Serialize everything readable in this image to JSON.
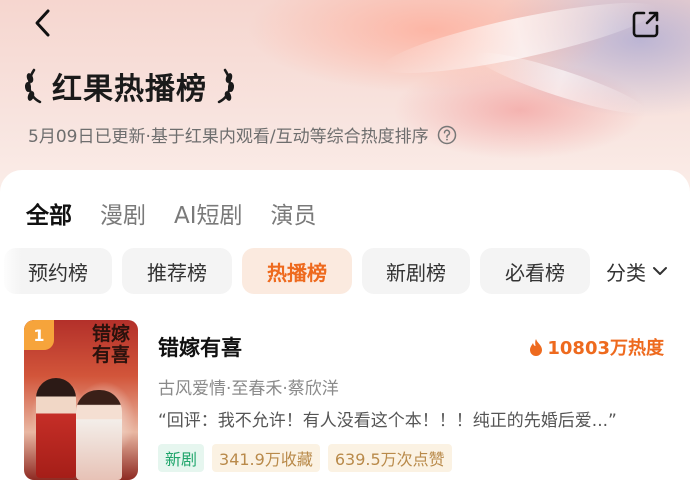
{
  "header": {
    "title": "红果热播榜",
    "subtitle": "5月09日已更新·基于红果内观看/互动等综合热度排序"
  },
  "tabs": [
    {
      "label": "全部",
      "active": true
    },
    {
      "label": "漫剧",
      "active": false
    },
    {
      "label": "AI短剧",
      "active": false
    },
    {
      "label": "演员",
      "active": false
    }
  ],
  "chips": [
    {
      "label": "预约榜",
      "active": false
    },
    {
      "label": "推荐榜",
      "active": false
    },
    {
      "label": "热播榜",
      "active": true
    },
    {
      "label": "新剧榜",
      "active": false
    },
    {
      "label": "必看榜",
      "active": false
    }
  ],
  "category_label": "分类",
  "items": [
    {
      "rank": "1",
      "poster_title": "错嫁有喜",
      "title": "错嫁有喜",
      "heat": "10803万热度",
      "meta": "古风爱情·至春禾·蔡欣洋",
      "quote": "“回评：我不允许！有人没看这个本！！！纯正的先婚后爱...”",
      "tags": [
        {
          "label": "新剧",
          "style": "green"
        },
        {
          "label": "341.9万收藏",
          "style": "tan"
        },
        {
          "label": "639.5万次点赞",
          "style": "tan"
        }
      ]
    }
  ],
  "colors": {
    "accent": "#ee6a1e",
    "rank_badge": "#f6a43b",
    "tag_green": "#1fa56b",
    "tag_tan": "#b98a4a"
  },
  "icons": {
    "back": "chevron-left-icon",
    "share": "share-icon",
    "help": "question-circle-icon",
    "heat": "flame-icon",
    "dropdown": "chevron-down-icon"
  }
}
